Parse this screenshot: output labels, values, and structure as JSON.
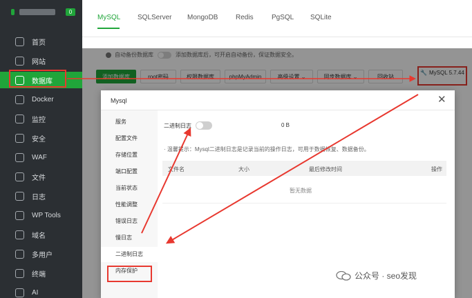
{
  "sidebar": {
    "badge": "0",
    "items": [
      {
        "label": "首页",
        "icon": "home-icon"
      },
      {
        "label": "网站",
        "icon": "globe-icon"
      },
      {
        "label": "数据库",
        "icon": "database-icon"
      },
      {
        "label": "Docker",
        "icon": "docker-icon"
      },
      {
        "label": "监控",
        "icon": "monitor-icon"
      },
      {
        "label": "安全",
        "icon": "shield-icon"
      },
      {
        "label": "WAF",
        "icon": "waf-icon"
      },
      {
        "label": "文件",
        "icon": "folder-icon"
      },
      {
        "label": "日志",
        "icon": "log-icon"
      },
      {
        "label": "WP Tools",
        "icon": "wordpress-icon"
      },
      {
        "label": "域名",
        "icon": "domain-icon"
      },
      {
        "label": "多用户",
        "icon": "users-icon"
      },
      {
        "label": "终端",
        "icon": "terminal-icon"
      },
      {
        "label": "AI",
        "icon": "ai-icon"
      }
    ],
    "active_index": 2
  },
  "db_tabs": [
    "MySQL",
    "SQLServer",
    "MongoDB",
    "Redis",
    "PgSQL",
    "SQLite"
  ],
  "notice": {
    "label": "自动备份数据库",
    "text": "添加数据库后，可开启自动备份，保证数据安全。"
  },
  "toolbar": {
    "add": "添加数据库",
    "root": "root密码",
    "perm": "权限数据库",
    "phpmyadmin": "phpMyAdmin",
    "advanced": "高级设置",
    "sync": "同步数据库",
    "recycle": "回收站",
    "version": "MySQL 5.7.44"
  },
  "dialog": {
    "title": "Mysql",
    "nav": [
      "服务",
      "配置文件",
      "存储位置",
      "端口配置",
      "当前状态",
      "性能调整",
      "错误日志",
      "慢日志",
      "二进制日志",
      "内存保护"
    ],
    "active_nav": 8,
    "binlog_label": "二进制日志",
    "binlog_size": "0 B",
    "hint": "· 温馨提示：Mysql二进制日志是记录当前的操作日志，可用于数据恢复、数据备份。",
    "table_headers": [
      "文件名",
      "大小",
      "最后修改时间",
      "操作"
    ],
    "empty_text": "暂无数据"
  },
  "watermark": "公众号 · seo发现",
  "colors": {
    "accent": "#20a53a",
    "highlight": "#e8382f",
    "sidebar": "#2b2f33"
  }
}
